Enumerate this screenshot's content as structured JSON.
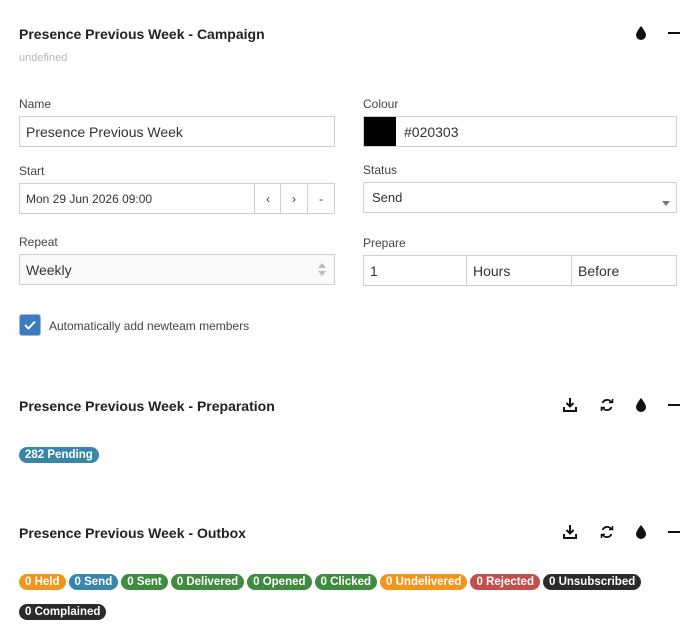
{
  "campaign": {
    "title": "Presence Previous Week - Campaign",
    "subtitle": "undefined",
    "name_label": "Name",
    "name_value": "Presence Previous Week",
    "colour_label": "Colour",
    "colour_value": "#020303",
    "start_label": "Start",
    "start_value": "Mon 29 Jun 2026 09:00",
    "start_prev": "‹",
    "start_next": "›",
    "start_clear": "-",
    "status_label": "Status",
    "status_value": "Send",
    "repeat_label": "Repeat",
    "repeat_value": "Weekly",
    "prepare_label": "Prepare",
    "prepare_amount": "1",
    "prepare_unit": "Hours",
    "prepare_when": "Before",
    "auto_add_label": "Automatically add newteam members",
    "auto_add_checked": true
  },
  "preparation": {
    "title": "Presence Previous Week - Preparation",
    "badges": [
      {
        "text": "282 Pending",
        "color": "#3a86a8"
      }
    ]
  },
  "outbox": {
    "title": "Presence Previous Week - Outbox",
    "badges_row1": [
      {
        "text": "0 Held",
        "color": "#f0961e"
      },
      {
        "text": "0 Send",
        "color": "#3a86a8"
      },
      {
        "text": "0 Sent",
        "color": "#3f8b3f"
      },
      {
        "text": "0 Delivered",
        "color": "#3f8b3f"
      },
      {
        "text": "0 Opened",
        "color": "#3f8b3f"
      },
      {
        "text": "0 Clicked",
        "color": "#3f8b3f"
      },
      {
        "text": "0 Undelivered",
        "color": "#f0961e"
      },
      {
        "text": "0 Rejected",
        "color": "#c0504d"
      },
      {
        "text": "0 Unsubscribed",
        "color": "#2b2b2b"
      }
    ],
    "badges_row2": [
      {
        "text": "0 Complained",
        "color": "#2b2b2b"
      }
    ]
  },
  "colors": {
    "checkbox": "#3b7bbf",
    "swatch": "#020303"
  },
  "icons": [
    "drop-icon",
    "collapse-icon",
    "download-icon",
    "refresh-icon"
  ]
}
